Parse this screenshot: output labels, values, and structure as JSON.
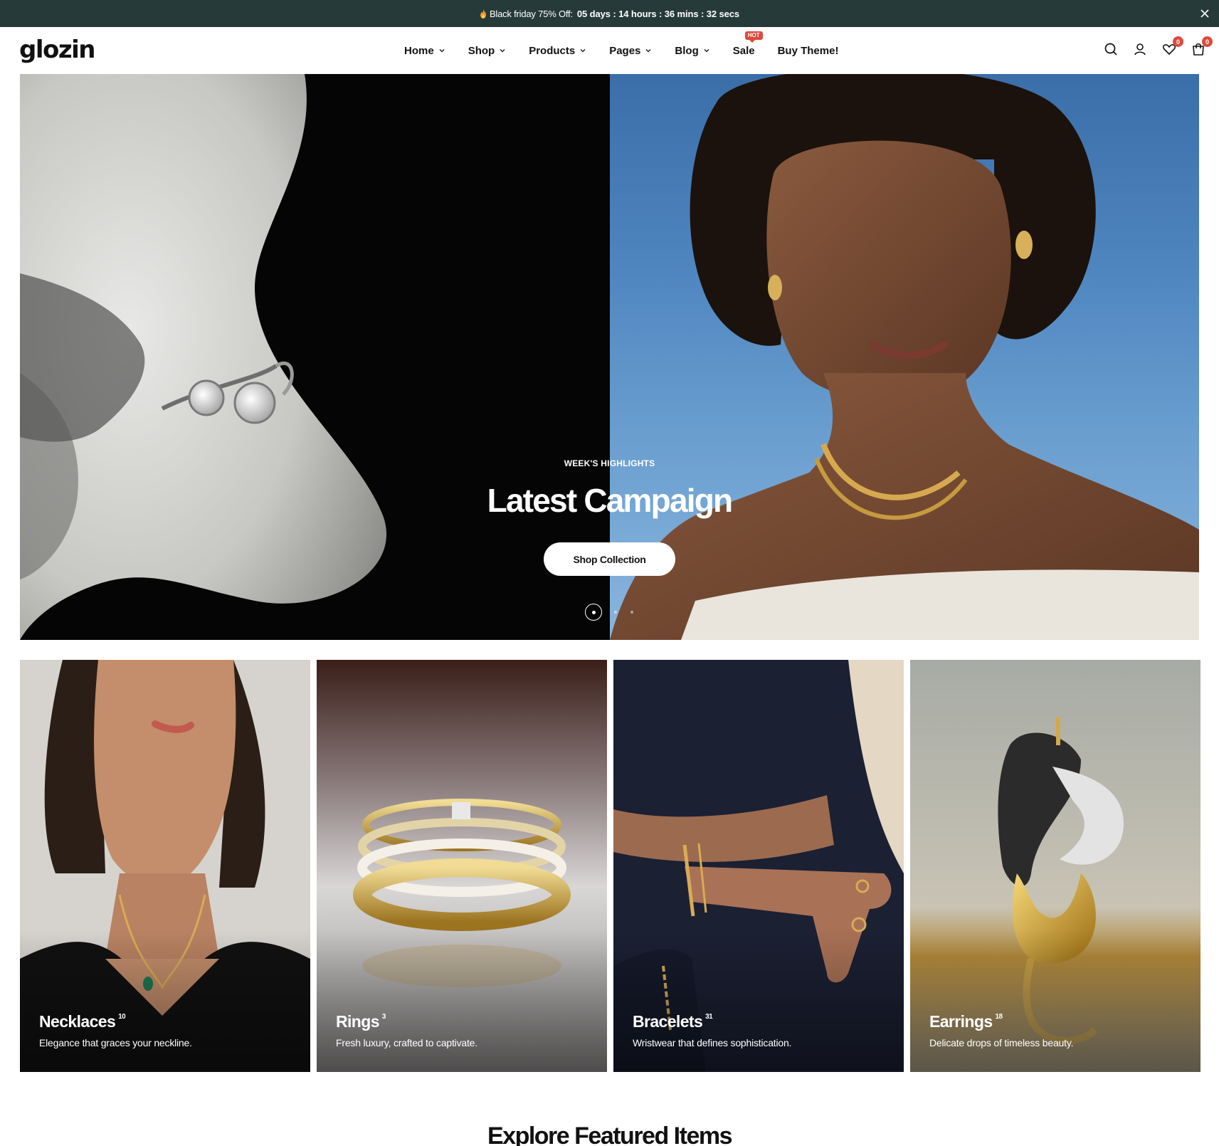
{
  "announcement": {
    "prefix": "Black friday 75% Off:",
    "countdown": "05 days : 14 hours : 36 mins : 32 secs"
  },
  "header": {
    "logo": "glozin",
    "nav": [
      {
        "label": "Home"
      },
      {
        "label": "Shop"
      },
      {
        "label": "Products"
      },
      {
        "label": "Pages"
      },
      {
        "label": "Blog"
      },
      {
        "label": "Sale",
        "badge": "HOT"
      },
      {
        "label": "Buy Theme!"
      }
    ],
    "wishlist_count": "0",
    "cart_count": "0"
  },
  "hero": {
    "eyebrow": "WEEK'S HIGHLIGHTS",
    "title": "Latest Campaign",
    "button": "Shop Collection",
    "slides_total": 3,
    "active_slide": 1
  },
  "categories": [
    {
      "title": "Necklaces",
      "count": "10",
      "desc": "Elegance that graces your neckline."
    },
    {
      "title": "Rings",
      "count": "3",
      "desc": "Fresh luxury, crafted to captivate."
    },
    {
      "title": "Bracelets",
      "count": "31",
      "desc": "Wristwear that defines sophistication."
    },
    {
      "title": "Earrings",
      "count": "18",
      "desc": "Delicate drops of timeless beauty."
    }
  ],
  "featured": {
    "title": "Explore Featured Items"
  },
  "colors": {
    "announcement_bg": "#263a39",
    "badge": "#e0483c"
  }
}
